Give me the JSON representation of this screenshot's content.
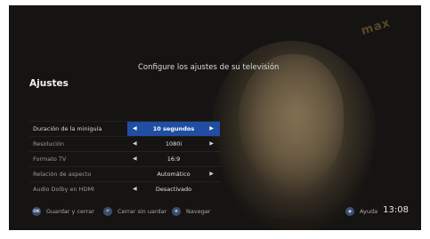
{
  "channel_logo": "max",
  "header": {
    "text": "Configure los ajustes de su televisión"
  },
  "section": {
    "title": "Ajustes"
  },
  "settings": [
    {
      "label": "Duración de la miniguía",
      "value": "10 segundos",
      "selected": true
    },
    {
      "label": "Resolución",
      "value": "1080i",
      "selected": false
    },
    {
      "label": "Formato TV",
      "value": "16:9",
      "selected": false
    },
    {
      "label": "Relación de aspecto",
      "value": "Automático",
      "selected": false
    },
    {
      "label": "Audio Dolby en HDMI",
      "value": "Desactivado",
      "selected": false
    }
  ],
  "footer": {
    "ok_key": "OK",
    "save_close": "Guardar y cerrar",
    "close_nosave": "Cerrar sin uardar",
    "navigate": "Navegar",
    "help": "Ayuda",
    "clock": "13:08"
  },
  "colors": {
    "selection": "#1f4ea3",
    "background": "#1e1e1c"
  },
  "icons": {
    "ok": "ok-icon",
    "back": "back-arrow-icon",
    "navigate": "dpad-icon",
    "help": "eye-icon",
    "arrow_left": "arrow-left-icon",
    "arrow_right": "arrow-right-icon"
  }
}
